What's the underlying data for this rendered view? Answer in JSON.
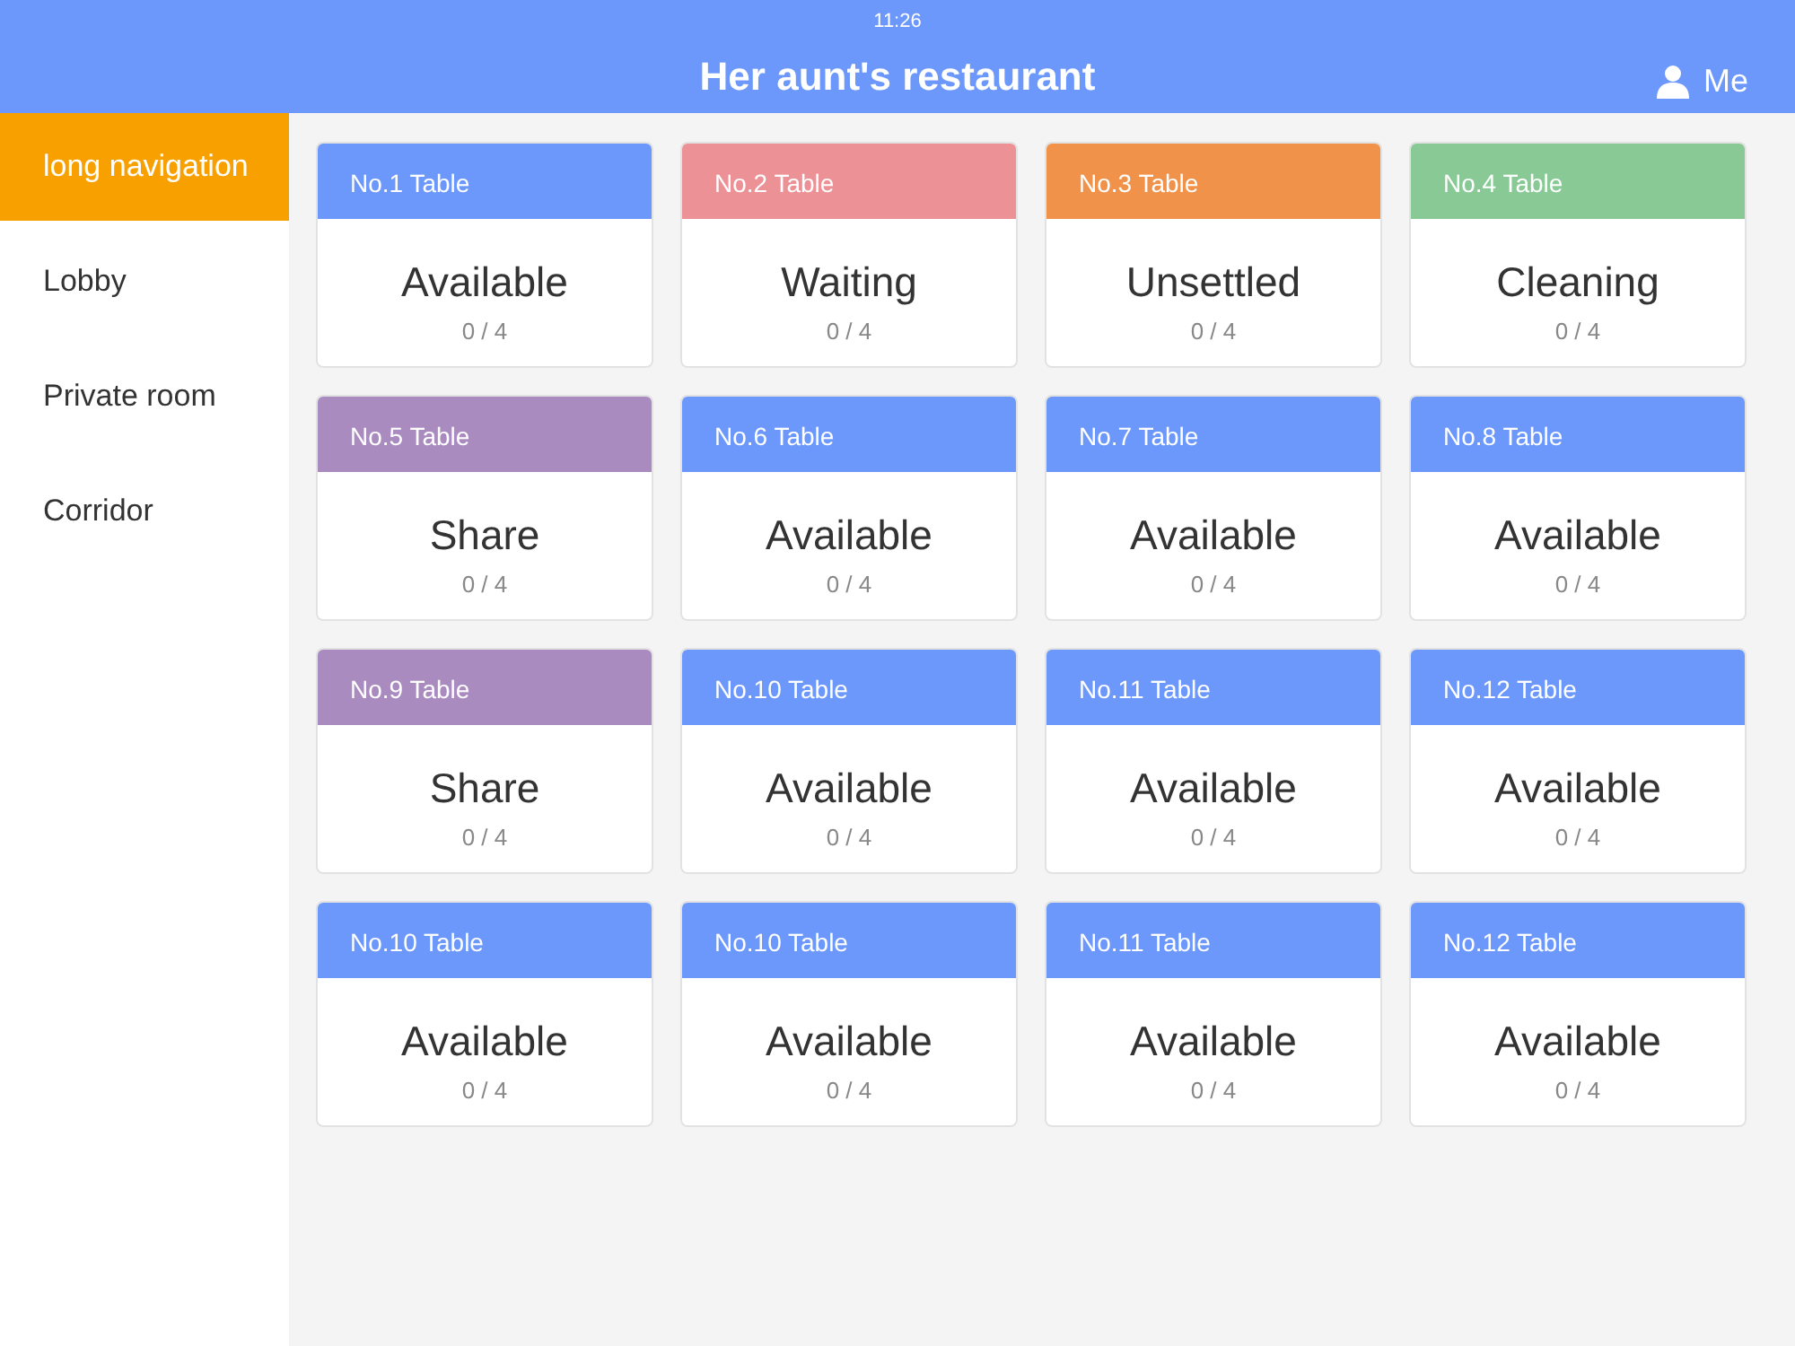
{
  "status_bar": {
    "time": "11:26"
  },
  "header": {
    "title": "Her aunt's restaurant",
    "user_label": "Me"
  },
  "sidebar": {
    "items": [
      {
        "label": "long navigation",
        "selected": true
      },
      {
        "label": "Lobby",
        "selected": false
      },
      {
        "label": "Private room",
        "selected": false
      },
      {
        "label": "Corridor",
        "selected": false
      }
    ]
  },
  "tables": [
    {
      "name": "No.1 Table",
      "status": "Available",
      "occupancy": "0 / 4",
      "color": "#6d98fb"
    },
    {
      "name": "No.2 Table",
      "status": "Waiting",
      "occupancy": "0 / 4",
      "color": "#ec9195"
    },
    {
      "name": "No.3 Table",
      "status": "Unsettled",
      "occupancy": "0 / 4",
      "color": "#f0924a"
    },
    {
      "name": "No.4 Table",
      "status": "Cleaning",
      "occupancy": "0 / 4",
      "color": "#88c996"
    },
    {
      "name": "No.5 Table",
      "status": "Share",
      "occupancy": "0 / 4",
      "color": "#a98bbf"
    },
    {
      "name": "No.6 Table",
      "status": "Available",
      "occupancy": "0 / 4",
      "color": "#6d98fb"
    },
    {
      "name": "No.7 Table",
      "status": "Available",
      "occupancy": "0 / 4",
      "color": "#6d98fb"
    },
    {
      "name": "No.8 Table",
      "status": "Available",
      "occupancy": "0 / 4",
      "color": "#6d98fb"
    },
    {
      "name": "No.9 Table",
      "status": "Share",
      "occupancy": "0 / 4",
      "color": "#a98bbf"
    },
    {
      "name": "No.10 Table",
      "status": "Available",
      "occupancy": "0 / 4",
      "color": "#6d98fb"
    },
    {
      "name": "No.11 Table",
      "status": "Available",
      "occupancy": "0 / 4",
      "color": "#6d98fb"
    },
    {
      "name": "No.12 Table",
      "status": "Available",
      "occupancy": "0 / 4",
      "color": "#6d98fb"
    },
    {
      "name": "No.10 Table",
      "status": "Available",
      "occupancy": "0 / 4",
      "color": "#6d98fb"
    },
    {
      "name": "No.10 Table",
      "status": "Available",
      "occupancy": "0 / 4",
      "color": "#6d98fb"
    },
    {
      "name": "No.11 Table",
      "status": "Available",
      "occupancy": "0 / 4",
      "color": "#6d98fb"
    },
    {
      "name": "No.12 Table",
      "status": "Available",
      "occupancy": "0 / 4",
      "color": "#6d98fb"
    }
  ]
}
